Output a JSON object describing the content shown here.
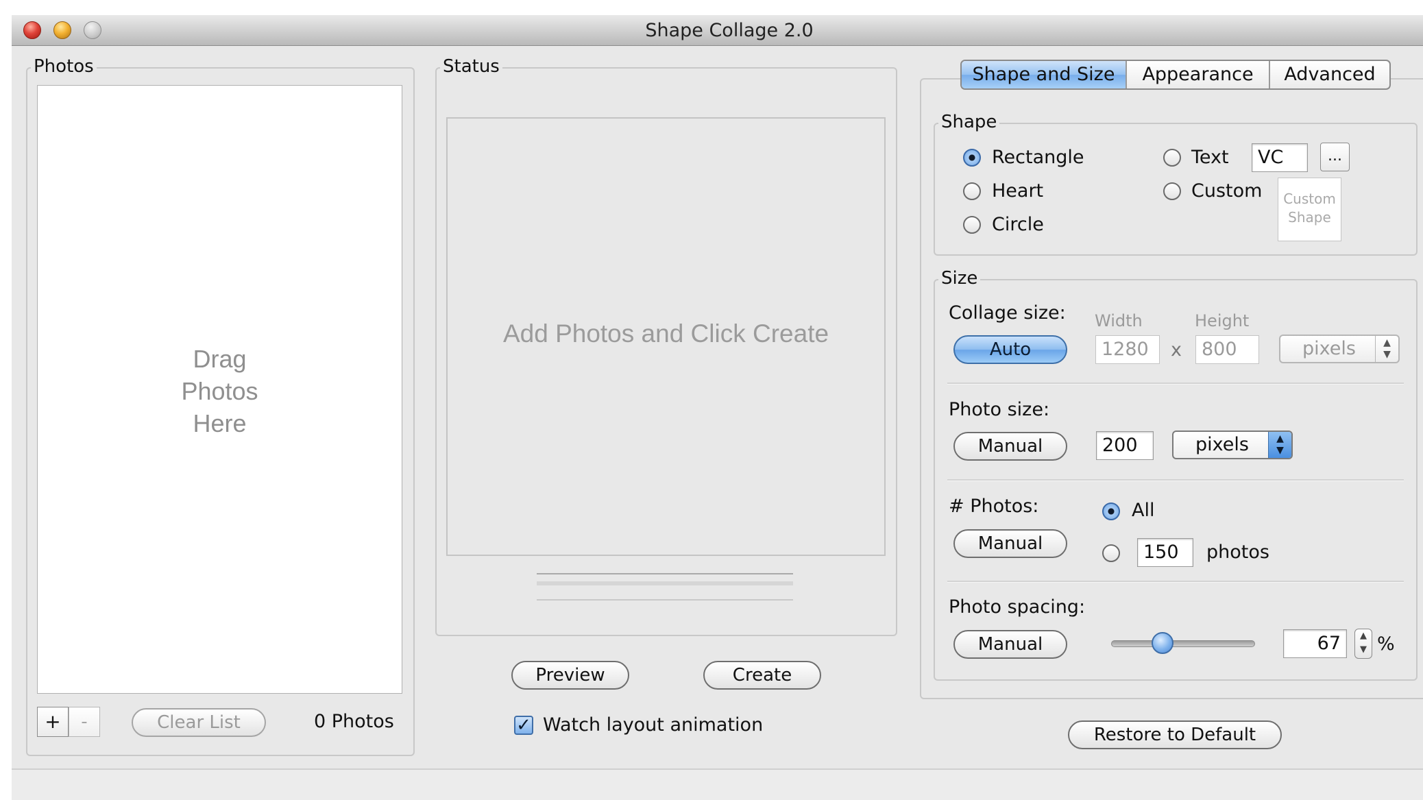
{
  "window": {
    "title": "Shape Collage 2.0"
  },
  "photos_panel": {
    "label": "Photos",
    "drop_hint_line1": "Drag",
    "drop_hint_line2": "Photos",
    "drop_hint_line3": "Here",
    "add_label": "+",
    "remove_label": "-",
    "clear_label": "Clear List",
    "count_text": "0 Photos"
  },
  "status_panel": {
    "label": "Status",
    "preview_hint": "Add Photos and Click Create",
    "preview_label": "Preview",
    "create_label": "Create",
    "watch_label": "Watch layout animation",
    "watch_checked": true
  },
  "tabs": [
    {
      "label": "Shape and Size",
      "selected": true
    },
    {
      "label": "Appearance",
      "selected": false
    },
    {
      "label": "Advanced",
      "selected": false
    }
  ],
  "shape_group": {
    "label": "Shape",
    "options": {
      "rectangle": "Rectangle",
      "heart": "Heart",
      "circle": "Circle",
      "text": "Text",
      "custom": "Custom"
    },
    "selected": "rectangle",
    "text_value": "VC",
    "ellipsis_label": "...",
    "custom_preview_line1": "Custom",
    "custom_preview_line2": "Shape"
  },
  "size_group": {
    "label": "Size",
    "collage": {
      "label": "Collage size:",
      "mode_label": "Auto",
      "width_label": "Width",
      "height_label": "Height",
      "width": "1280",
      "times": "x",
      "height": "800",
      "unit": "pixels"
    },
    "photo_size": {
      "label": "Photo size:",
      "mode_label": "Manual",
      "value": "200",
      "unit": "pixels"
    },
    "num_photos": {
      "label": "# Photos:",
      "mode_label": "Manual",
      "all_label": "All",
      "count_value": "150",
      "count_unit": "photos",
      "selected": "all"
    },
    "spacing": {
      "label": "Photo spacing:",
      "mode_label": "Manual",
      "value": "67",
      "unit": "%",
      "slider_fraction": 0.33
    }
  },
  "restore_label": "Restore to Default",
  "colors": {
    "accent_blue": "#78adeb",
    "window_bg": "#e8e8e8"
  }
}
